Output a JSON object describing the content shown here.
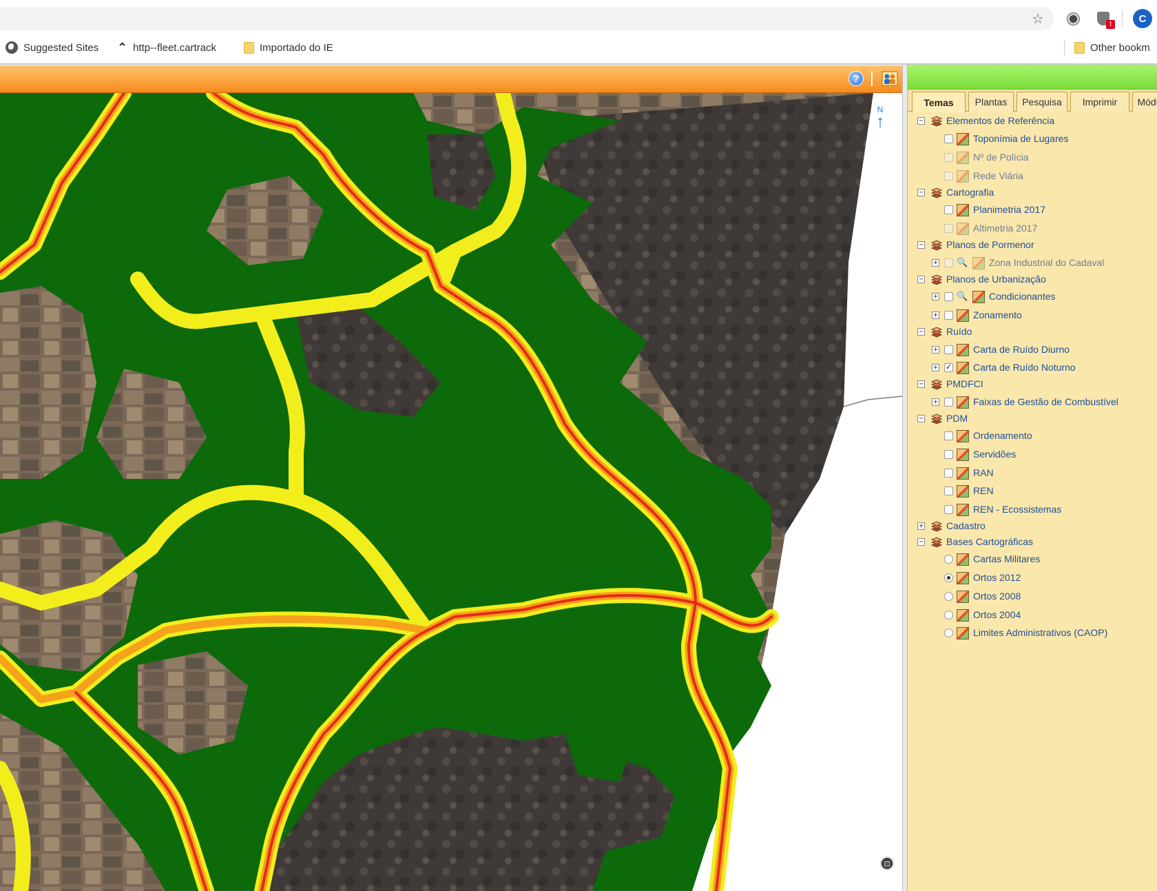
{
  "bookmarks": {
    "suggested": "Suggested Sites",
    "fleet": "http--fleet.cartrack",
    "importado": "Importado do IE",
    "other": "Other bookm"
  },
  "profile": {
    "initial": "C"
  },
  "extension_badge": "!",
  "tabs": [
    "Temas",
    "Plantas",
    "Pesquisa",
    "Imprimir",
    "Módu"
  ],
  "active_tab": "Temas",
  "north_label": "N",
  "tree": [
    {
      "kind": "group",
      "label": "Elementos de Referência"
    },
    {
      "kind": "layer",
      "label": "Toponímia de Lugares",
      "checked": false,
      "dim": false
    },
    {
      "kind": "layer",
      "label": "Nº de Polícia",
      "checked": false,
      "dim": true
    },
    {
      "kind": "layer",
      "label": "Rede Viária",
      "checked": false,
      "dim": true
    },
    {
      "kind": "group",
      "label": "Cartografia"
    },
    {
      "kind": "layer",
      "label": "Planimetria 2017",
      "checked": false,
      "dim": false
    },
    {
      "kind": "layer",
      "label": "Altimetria 2017",
      "checked": false,
      "dim": true
    },
    {
      "kind": "group",
      "label": "Planos de Pormenor"
    },
    {
      "kind": "sublayer",
      "label": "Zona Industrial do Cadaval",
      "checked": false,
      "dim": true,
      "zoom": true
    },
    {
      "kind": "group",
      "label": "Planos de Urbanização"
    },
    {
      "kind": "sublayer",
      "label": "Condicionantes",
      "checked": false,
      "dim": false,
      "zoom": true
    },
    {
      "kind": "sublayer",
      "label": "Zonamento",
      "checked": false,
      "dim": false,
      "zoom": false
    },
    {
      "kind": "group",
      "label": "Ruído"
    },
    {
      "kind": "sublayer",
      "label": "Carta de Ruído Diurno",
      "checked": false,
      "dim": false,
      "zoom": false
    },
    {
      "kind": "sublayer",
      "label": "Carta de Ruído Noturno",
      "checked": true,
      "dim": false,
      "zoom": false
    },
    {
      "kind": "group",
      "label": "PMDFCI"
    },
    {
      "kind": "sublayer",
      "label": "Faixas de Gestão de Combustível",
      "checked": false,
      "dim": false,
      "zoom": false
    },
    {
      "kind": "group",
      "label": "PDM"
    },
    {
      "kind": "layer",
      "label": "Ordenamento",
      "checked": false,
      "dim": false
    },
    {
      "kind": "layer",
      "label": "Servidões",
      "checked": false,
      "dim": false
    },
    {
      "kind": "layer",
      "label": "RAN",
      "checked": false,
      "dim": false
    },
    {
      "kind": "layer",
      "label": "REN",
      "checked": false,
      "dim": false
    },
    {
      "kind": "layer",
      "label": "REN - Ecossistemas",
      "checked": false,
      "dim": false
    },
    {
      "kind": "group-collapsed",
      "label": "Cadastro"
    },
    {
      "kind": "group",
      "label": "Bases Cartográficas"
    },
    {
      "kind": "radio",
      "label": "Cartas Militares",
      "selected": false
    },
    {
      "kind": "radio",
      "label": "Ortos 2012",
      "selected": true
    },
    {
      "kind": "radio",
      "label": "Ortos 2008",
      "selected": false
    },
    {
      "kind": "radio",
      "label": "Ortos 2004",
      "selected": false
    },
    {
      "kind": "radio",
      "label": "Limites Administrativos (CAOP)",
      "selected": false
    }
  ],
  "colors": {
    "noise_zone_green": "#0c6a0a",
    "road_buffer_yellow": "#f2ee1c",
    "road_buffer_orange": "#f5a11c",
    "road_core_red": "#e62a17",
    "orthophoto_dark": "#4a4440",
    "orthophoto_field": "#7c6a58"
  }
}
